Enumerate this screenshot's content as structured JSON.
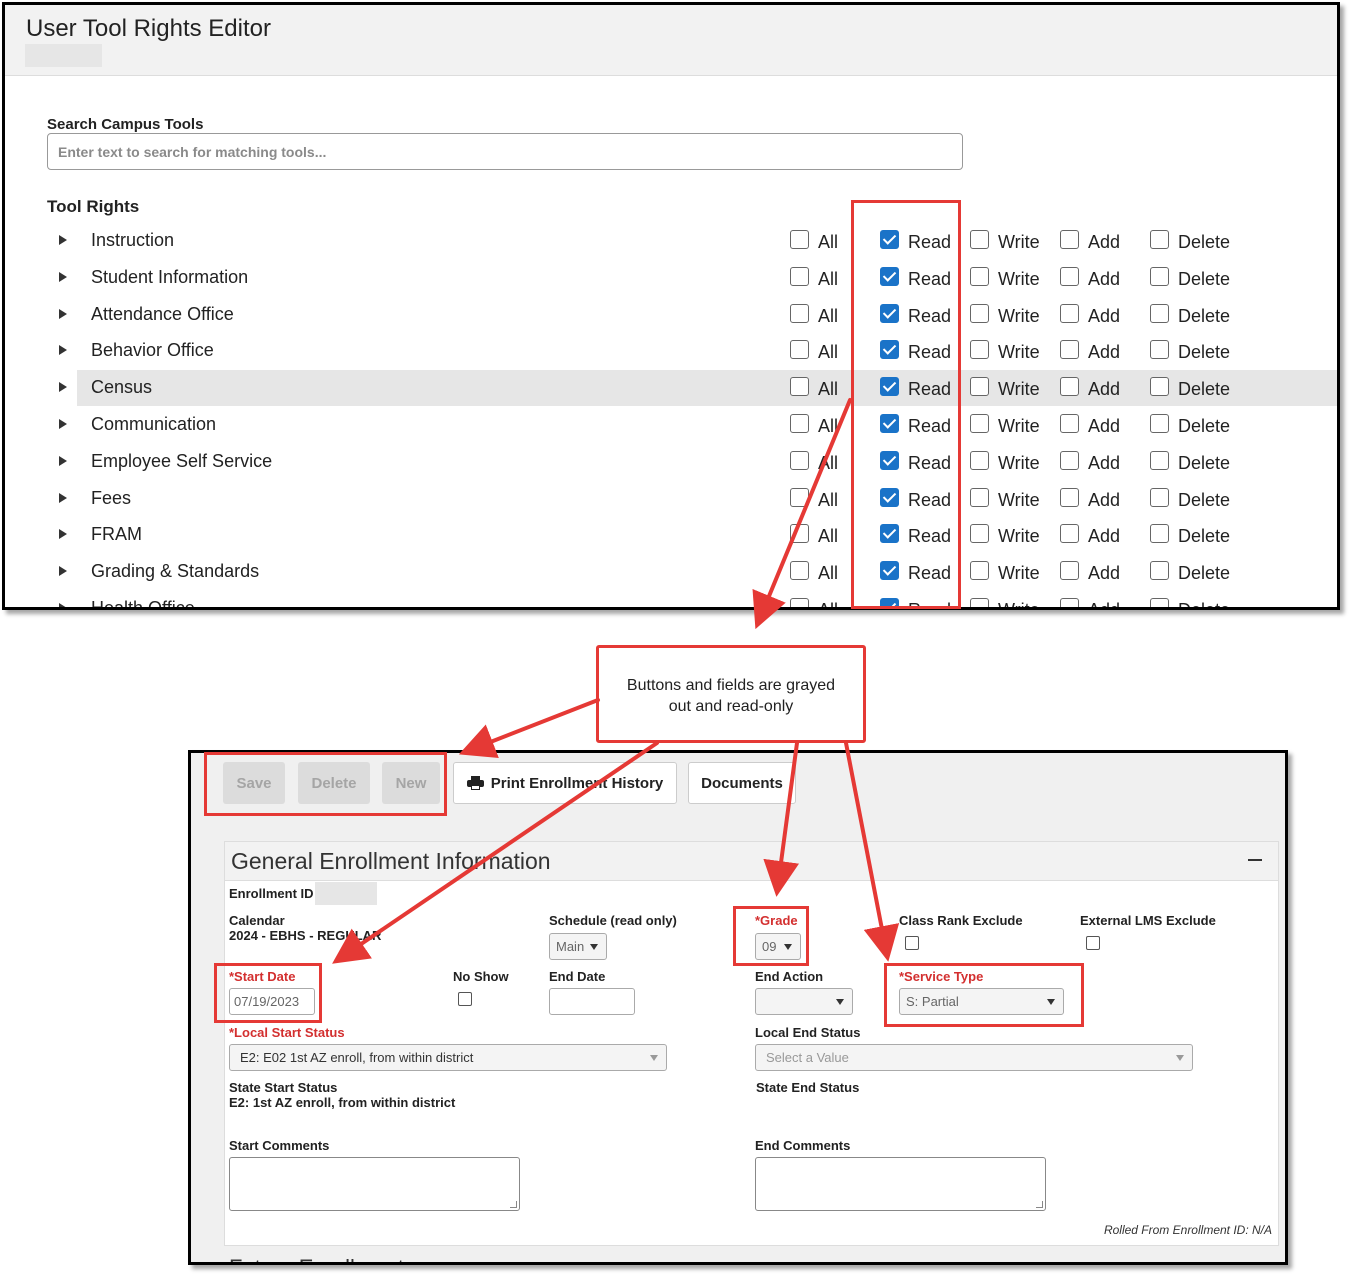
{
  "tool_rights_editor": {
    "title": "User Tool Rights Editor",
    "search_label": "Search Campus Tools",
    "search_placeholder": "Enter text to search for matching tools...",
    "tool_rights_label": "Tool Rights",
    "permission_labels": [
      "All",
      "Read",
      "Write",
      "Add",
      "Delete"
    ],
    "tools": [
      {
        "name": "Instruction",
        "all": false,
        "read": true,
        "write": false,
        "add": false,
        "delete": false
      },
      {
        "name": "Student Information",
        "all": false,
        "read": true,
        "write": false,
        "add": false,
        "delete": false
      },
      {
        "name": "Attendance Office",
        "all": false,
        "read": true,
        "write": false,
        "add": false,
        "delete": false
      },
      {
        "name": "Behavior Office",
        "all": false,
        "read": true,
        "write": false,
        "add": false,
        "delete": false
      },
      {
        "name": "Census",
        "all": false,
        "read": true,
        "write": false,
        "add": false,
        "delete": false,
        "highlighted": true
      },
      {
        "name": "Communication",
        "all": false,
        "read": true,
        "write": false,
        "add": false,
        "delete": false
      },
      {
        "name": "Employee Self Service",
        "all": false,
        "read": true,
        "write": false,
        "add": false,
        "delete": false
      },
      {
        "name": "Fees",
        "all": false,
        "read": true,
        "write": false,
        "add": false,
        "delete": false
      },
      {
        "name": "FRAM",
        "all": false,
        "read": true,
        "write": false,
        "add": false,
        "delete": false
      },
      {
        "name": "Grading & Standards",
        "all": false,
        "read": true,
        "write": false,
        "add": false,
        "delete": false
      },
      {
        "name": "Health Office",
        "all": false,
        "read": true,
        "write": false,
        "add": false,
        "delete": false
      }
    ]
  },
  "callout": {
    "line1": "Buttons and fields are grayed",
    "line2": "out and read-only"
  },
  "enrollment": {
    "toolbar": {
      "save": "Save",
      "delete": "Delete",
      "new": "New",
      "print": "Print Enrollment History",
      "documents": "Documents"
    },
    "section_title": "General Enrollment Information",
    "enrollment_id_label": "Enrollment ID",
    "calendar_label": "Calendar",
    "calendar_value": "2024 - EBHS - REGULAR",
    "schedule_label": "Schedule (read only)",
    "schedule_value": "Main",
    "grade_label": "*Grade",
    "grade_value": "09",
    "class_rank_label": "Class Rank Exclude",
    "external_lms_label": "External LMS Exclude",
    "start_date_label": "*Start Date",
    "start_date_value": "07/19/2023",
    "no_show_label": "No Show",
    "end_date_label": "End Date",
    "end_action_label": "End Action",
    "service_type_label": "*Service Type",
    "service_type_value": "S: Partial",
    "local_start_label": "*Local Start Status",
    "local_start_value": "E2: E02 1st AZ enroll, from within district",
    "local_end_label": "Local End Status",
    "local_end_placeholder": "Select a Value",
    "state_start_label": "State Start Status",
    "state_start_value": "E2: 1st AZ enroll, from within district",
    "state_end_label": "State End Status",
    "start_comments_label": "Start Comments",
    "end_comments_label": "End Comments",
    "rolled_from": "Rolled From Enrollment ID: N/A",
    "next_section_title": "Future Enrollment"
  },
  "colors": {
    "annotation_red": "#e53935",
    "checkbox_blue": "#1a73c8",
    "required_red": "#d32f2f"
  }
}
